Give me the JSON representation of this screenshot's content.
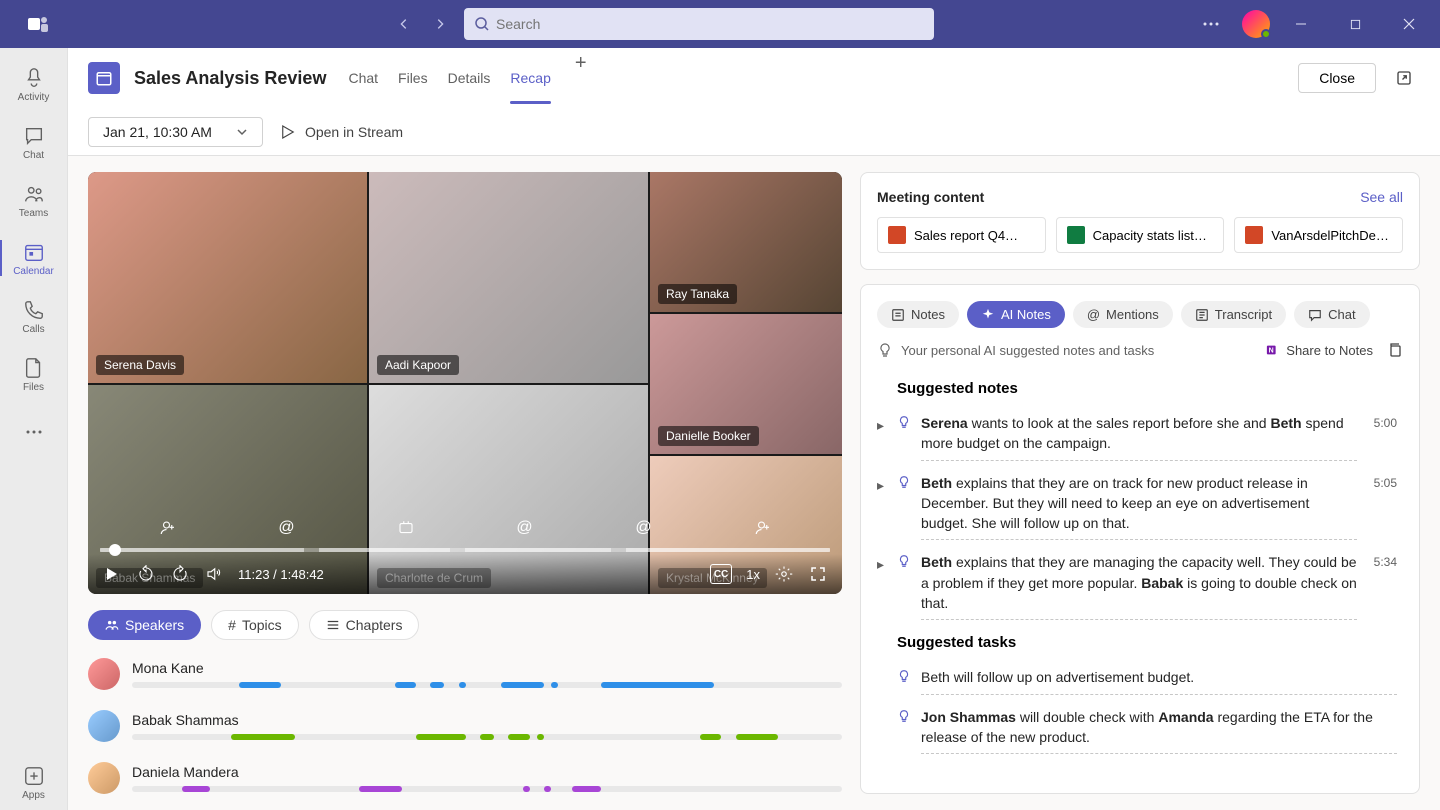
{
  "titlebar": {
    "search_placeholder": "Search"
  },
  "rail": {
    "activity": "Activity",
    "chat": "Chat",
    "teams": "Teams",
    "calendar": "Calendar",
    "calls": "Calls",
    "files": "Files",
    "apps": "Apps"
  },
  "header": {
    "title": "Sales Analysis Review",
    "tabs": {
      "chat": "Chat",
      "files": "Files",
      "details": "Details",
      "recap": "Recap"
    },
    "close": "Close"
  },
  "subbar": {
    "date": "Jan 21, 10:30 AM",
    "stream": "Open in Stream"
  },
  "video": {
    "participants": {
      "p1": "Serena Davis",
      "p2": "Aadi Kapoor",
      "p3": "Ray Tanaka",
      "p4": "Danielle Booker",
      "p5": "Babak Shammas",
      "p6": "Charlotte de Crum",
      "p7": "Krystal McKinney"
    },
    "time": "11:23 / 1:48:42",
    "speed": "1x",
    "cc": "CC"
  },
  "filters": {
    "speakers": "Speakers",
    "topics": "Topics",
    "chapters": "Chapters"
  },
  "speakers": [
    {
      "name": "Mona Kane",
      "color": "#2e8fe8",
      "segments": [
        [
          15,
          6
        ],
        [
          37,
          3
        ],
        [
          42,
          2
        ],
        [
          46,
          1
        ],
        [
          52,
          6
        ],
        [
          59,
          1
        ],
        [
          66,
          16
        ]
      ]
    },
    {
      "name": "Babak Shammas",
      "color": "#6bb700",
      "segments": [
        [
          14,
          9
        ],
        [
          40,
          7
        ],
        [
          49,
          2
        ],
        [
          53,
          3
        ],
        [
          57,
          1
        ],
        [
          80,
          3
        ],
        [
          85,
          6
        ]
      ]
    },
    {
      "name": "Daniela Mandera",
      "color": "#a846d6",
      "segments": [
        [
          7,
          4
        ],
        [
          32,
          6
        ],
        [
          55,
          1
        ],
        [
          58,
          1
        ],
        [
          62,
          4
        ]
      ]
    }
  ],
  "content_card": {
    "title": "Meeting content",
    "see_all": "See all",
    "files": [
      {
        "name": "Sales report Q4…",
        "app": "ppt"
      },
      {
        "name": "Capacity stats list…",
        "app": "xls"
      },
      {
        "name": "VanArsdelPitchDe…",
        "app": "ppt"
      }
    ]
  },
  "notes": {
    "tabs": {
      "notes": "Notes",
      "ai": "AI Notes",
      "mentions": "Mentions",
      "transcript": "Transcript",
      "chat": "Chat"
    },
    "hint": "Your personal AI suggested notes and tasks",
    "share": "Share to Notes",
    "section_notes": "Suggested notes",
    "section_tasks": "Suggested tasks",
    "items": [
      {
        "ts": "5:00",
        "html": "<b>Serena</b> wants to look at the sales report before she and <b>Beth</b> spend more budget on the campaign."
      },
      {
        "ts": "5:05",
        "html": "<b>Beth</b> explains that they are on track for new product release in December. But they will need to keep an eye on advertisement budget. She will follow up on that."
      },
      {
        "ts": "5:34",
        "html": "<b>Beth</b> explains that they are managing the capacity well. They could be a problem if they get more popular. <b>Babak</b> is going to double check on that."
      }
    ],
    "tasks": [
      {
        "html": "Beth will follow up on advertisement budget."
      },
      {
        "html": "<b>Jon Shammas</b> will double check with <b>Amanda</b> regarding the ETA for the release of the new product."
      }
    ]
  }
}
